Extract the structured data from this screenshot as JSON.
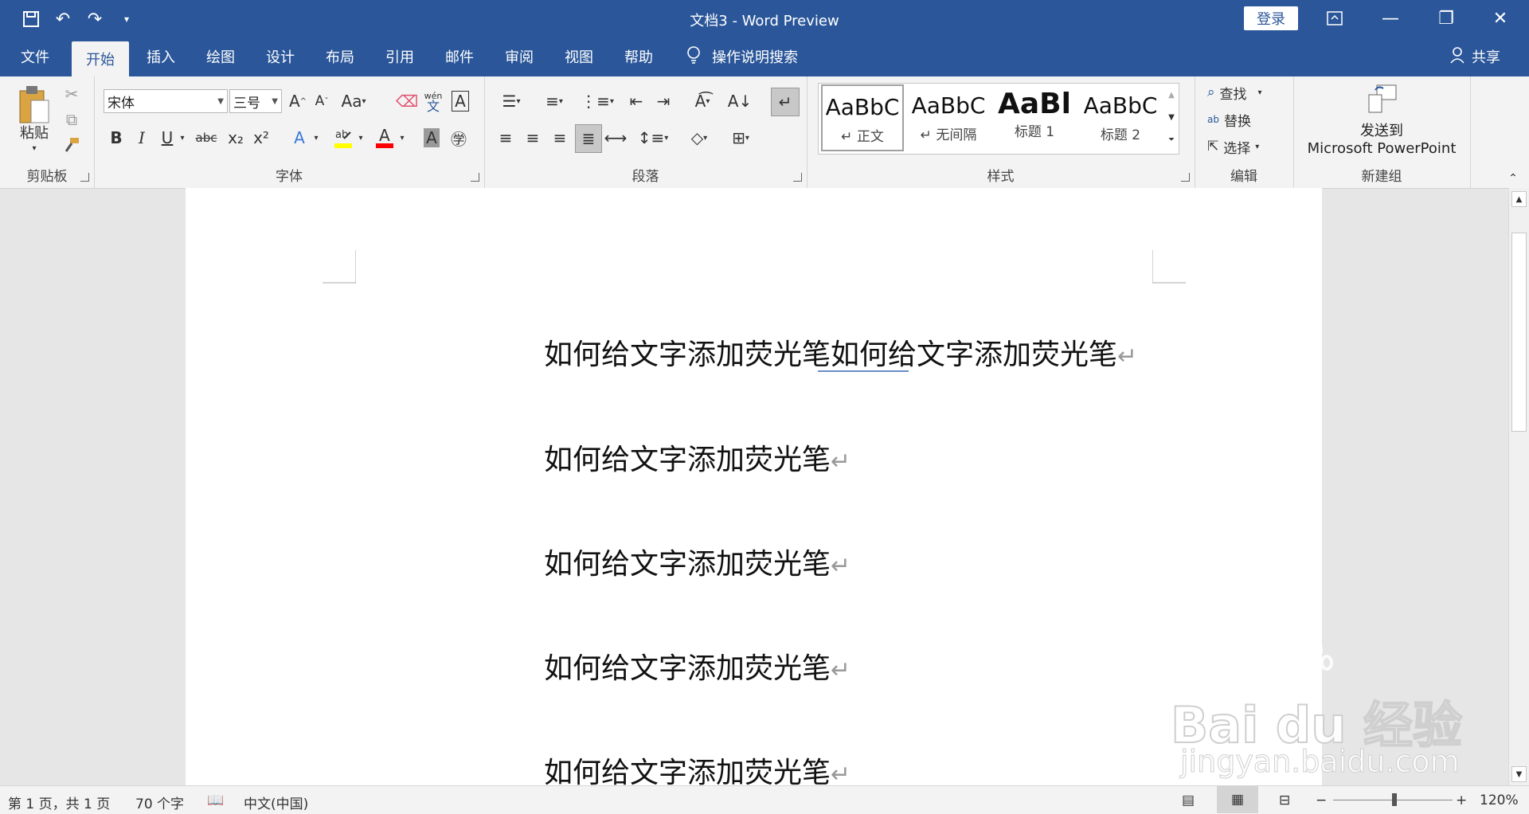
{
  "window": {
    "title": "文档3  -  Word Preview",
    "login_label": "登录"
  },
  "qat": {
    "save_icon": "save-icon",
    "undo_icon": "undo-icon",
    "redo_icon": "redo-icon",
    "customize_icon": "customize-qat-icon"
  },
  "tabs": [
    {
      "label": "文件"
    },
    {
      "label": "开始"
    },
    {
      "label": "插入"
    },
    {
      "label": "绘图"
    },
    {
      "label": "设计"
    },
    {
      "label": "布局"
    },
    {
      "label": "引用"
    },
    {
      "label": "邮件"
    },
    {
      "label": "审阅"
    },
    {
      "label": "视图"
    },
    {
      "label": "帮助"
    }
  ],
  "tell_me": "操作说明搜索",
  "share": "共享",
  "ribbon": {
    "clipboard": {
      "label": "剪贴板",
      "paste": "粘贴"
    },
    "font": {
      "label": "字体",
      "family": "宋体",
      "size": "三号",
      "case_label": "Aa",
      "phonetic_top": "wén",
      "phonetic_bottom": "文",
      "bold": "B",
      "italic": "I",
      "underline": "U",
      "strike": "abc",
      "subscript": "x₂",
      "superscript": "x²"
    },
    "paragraph": {
      "label": "段落"
    },
    "styles": {
      "label": "样式",
      "items": [
        {
          "preview": "AaBbC",
          "name": "↵ 正文"
        },
        {
          "preview": "AaBbC",
          "name": "↵ 无间隔"
        },
        {
          "preview": "AaBl",
          "name": "标题 1"
        },
        {
          "preview": "AaBbC",
          "name": "标题 2"
        }
      ]
    },
    "editing": {
      "label": "编辑",
      "find": "查找",
      "replace": "替换",
      "select": "选择"
    },
    "newgroup": {
      "label": "新建组",
      "send_line1": "发送到",
      "send_line2": "Microsoft PowerPoint"
    }
  },
  "document": {
    "paragraphs": [
      "如何给文字添加荧光笔如何给文字添加荧光笔",
      "如何给文字添加荧光笔",
      "如何给文字添加荧光笔",
      "如何给文字添加荧光笔",
      "如何给文字添加荧光笔"
    ],
    "paragraph_mark": "↵"
  },
  "status": {
    "page": "第 1 页，共 1 页",
    "words": "70 个字",
    "language": "中文(中国)",
    "zoom": "120%"
  },
  "watermark": {
    "brand": "Bai du 经验",
    "url": "jingyan.baidu.com"
  },
  "colors": {
    "accent": "#2b579a",
    "highlight": "#ffff00",
    "font_color": "#ff0000"
  }
}
